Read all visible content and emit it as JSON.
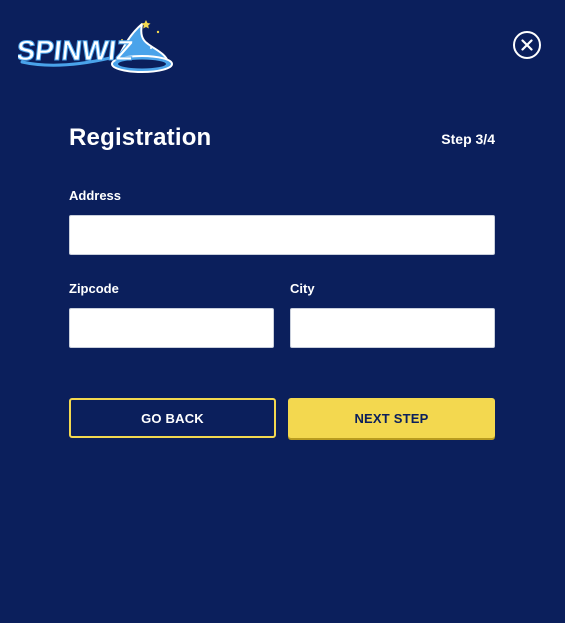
{
  "header": {
    "logo_text": "SPINWIZ",
    "close_icon": "close-icon"
  },
  "form": {
    "title": "Registration",
    "step": "Step 3/4",
    "address": {
      "label": "Address",
      "value": "",
      "placeholder": ""
    },
    "zipcode": {
      "label": "Zipcode",
      "value": "",
      "placeholder": ""
    },
    "city": {
      "label": "City",
      "value": "",
      "placeholder": ""
    }
  },
  "actions": {
    "back_label": "GO BACK",
    "next_label": "NEXT STEP"
  },
  "colors": {
    "background": "#0b1f5c",
    "accent": "#f3d84f",
    "logo_blue": "#4aa3ea"
  }
}
